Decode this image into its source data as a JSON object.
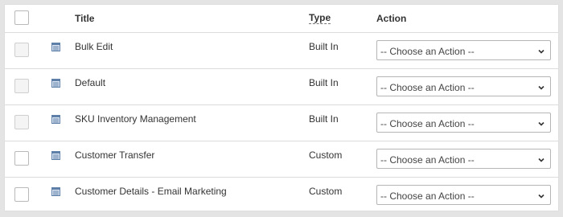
{
  "table": {
    "headers": {
      "title": "Title",
      "type": "Type",
      "action": "Action"
    },
    "rows": [
      {
        "title": "Bulk Edit",
        "type": "Built In",
        "action": "-- Choose an Action --",
        "selectable": false
      },
      {
        "title": "Default",
        "type": "Built In",
        "action": "-- Choose an Action --",
        "selectable": false
      },
      {
        "title": "SKU Inventory Management",
        "type": "Built In",
        "action": "-- Choose an Action --",
        "selectable": false
      },
      {
        "title": "Customer Transfer",
        "type": "Custom",
        "action": "-- Choose an Action --",
        "selectable": true
      },
      {
        "title": "Customer Details - Email Marketing",
        "type": "Custom",
        "action": "-- Choose an Action --",
        "selectable": true
      }
    ]
  },
  "icons": {
    "row_icon": "document-list-icon",
    "select_arrow": "chevron-down-icon"
  }
}
